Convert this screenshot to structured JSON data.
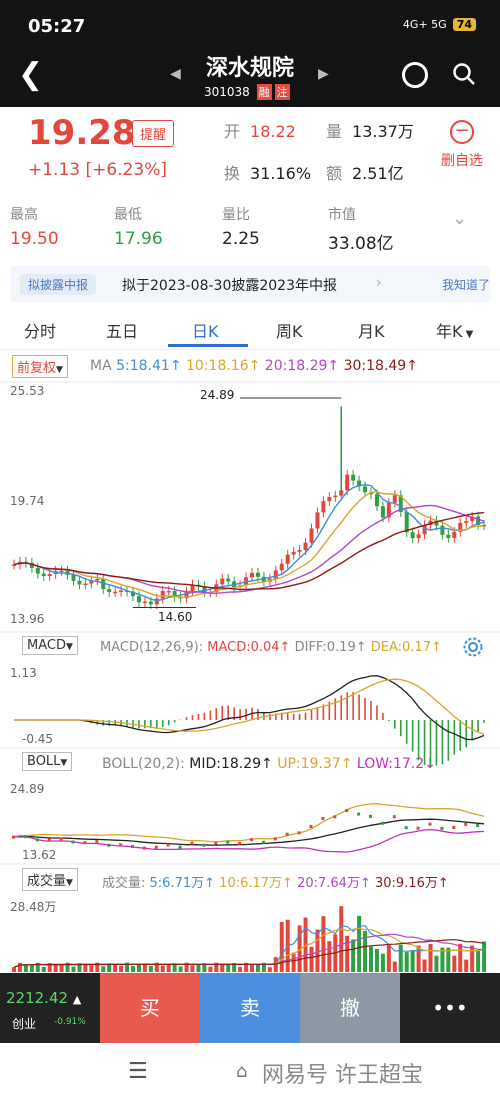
{
  "status": {
    "time": "05:27",
    "network": "4G+ 5G",
    "battery": "74"
  },
  "header": {
    "title": "深水规院",
    "code": "301038",
    "tag_rong": "融",
    "tag_zhu": "注"
  },
  "quote": {
    "price": "19.28",
    "remind_label": "提醒",
    "change": "+1.13 [+6.23%]",
    "open_k": "开",
    "open_v": "18.22",
    "vol_k": "量",
    "vol_v": "13.37万",
    "turn_k": "换",
    "turn_v": "31.16%",
    "amt_k": "额",
    "amt_v": "2.51亿",
    "delete_label": "删自选",
    "stats": [
      {
        "k": "最高",
        "v": "19.50",
        "color": "#e5463c"
      },
      {
        "k": "最低",
        "v": "17.96",
        "color": "#2ea043"
      },
      {
        "k": "量比",
        "v": "2.25",
        "color": "#222222"
      },
      {
        "k": "市值",
        "v": "33.08亿",
        "color": "#222222"
      }
    ]
  },
  "banner": {
    "pill": "拟披露中报",
    "text": "拟于2023-08-30披露2023年中报",
    "dismiss": "我知道了"
  },
  "tabs": [
    "分时",
    "五日",
    "日K",
    "周K",
    "月K",
    "年K"
  ],
  "kline": {
    "fq_label": "前复权",
    "ma": {
      "label": "MA",
      "ma5": "5:18.41↑",
      "ma10": "10:18.16↑",
      "ma20": "20:18.29↑",
      "ma30": "30:18.49↑"
    },
    "y_top": "25.53",
    "y_mid": "19.74",
    "y_bot": "13.96",
    "high_mark": "24.89",
    "low_mark": "14.60"
  },
  "macd": {
    "select": "MACD",
    "params": "MACD(12,26,9):",
    "macd": "MACD:0.04↑",
    "diff": "DIFF:0.19↑",
    "dea": "DEA:0.17↑",
    "y_top": "1.13",
    "y_bot": "-0.45"
  },
  "boll": {
    "select": "BOLL",
    "params": "BOLL(20,2):",
    "mid": "MID:18.29↑",
    "up": "UP:19.37↑",
    "low": "LOW:17.2↓",
    "y_top": "24.89",
    "y_bot": "13.62"
  },
  "vol": {
    "select": "成交量",
    "label": "成交量:",
    "v5": "5:6.71万↑",
    "v10": "10:6.17万↑",
    "v20": "20:7.64万↑",
    "v30": "30:9.16万↑",
    "y_top": "28.48万"
  },
  "trade": {
    "index_value": "2212.42",
    "index_name": "创业",
    "index_pct": "-0.91%",
    "buy": "买",
    "sell": "卖",
    "cancel": "撤",
    "more": "•••"
  },
  "nav": {
    "watermark": "网易号 许王超宝"
  },
  "colors": {
    "up": "#e5463c",
    "down": "#2ea043",
    "ma5": "#3a8fd8",
    "ma10": "#d8a62a",
    "ma20": "#b048c8",
    "ma30": "#8b1a1a"
  }
}
